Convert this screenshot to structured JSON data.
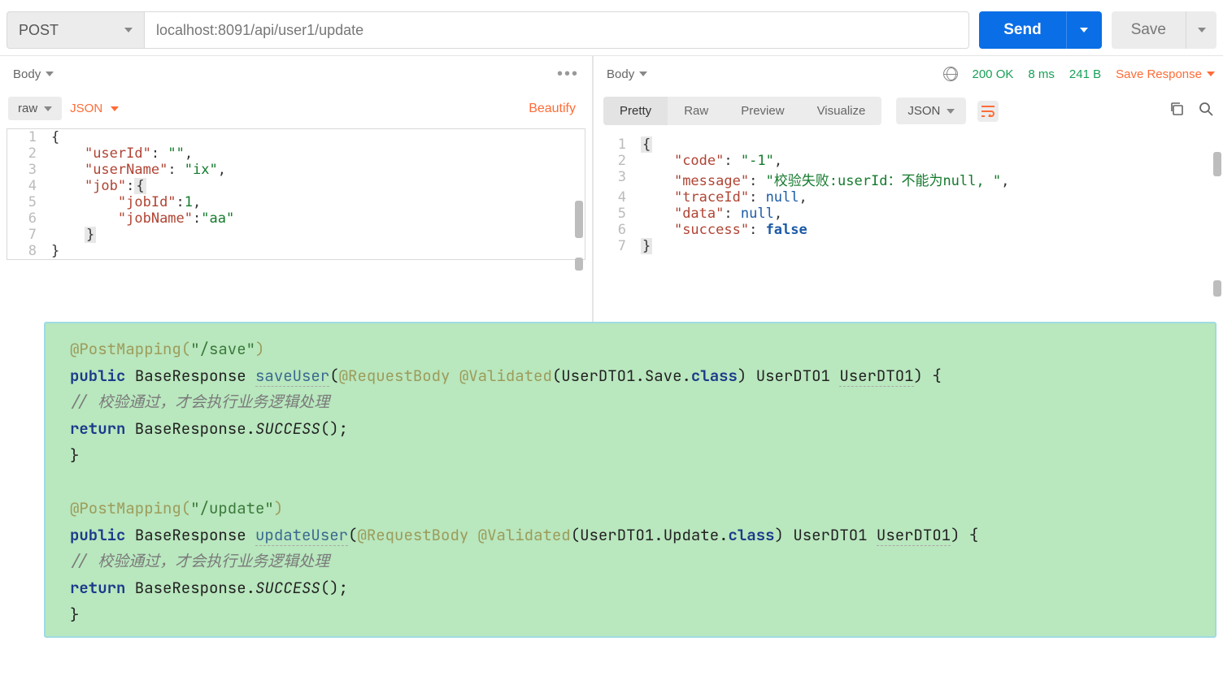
{
  "topbar": {
    "method": "POST",
    "url": "localhost:8091/api/user1/update",
    "send": "Send",
    "save": "Save"
  },
  "request": {
    "tab_label": "Body",
    "raw_label": "raw",
    "format_label": "JSON",
    "beautify": "Beautify",
    "body_lines": [
      {
        "n": 1,
        "html": "<span class='tok-punc'>{</span>"
      },
      {
        "n": 2,
        "html": "    <span class='tok-key'>\"userId\"</span><span class='tok-punc'>: </span><span class='tok-str'>\"\"</span><span class='tok-punc'>,</span>"
      },
      {
        "n": 3,
        "html": "    <span class='tok-key'>\"userName\"</span><span class='tok-punc'>: </span><span class='tok-str'>\"ix\"</span><span class='tok-punc'>,</span>"
      },
      {
        "n": 4,
        "html": "    <span class='tok-key'>\"job\"</span><span class='tok-punc'>:</span><span class='hl'>{</span>"
      },
      {
        "n": 5,
        "html": "        <span class='tok-key'>\"jobId\"</span><span class='tok-punc'>:</span><span class='tok-num'>1</span><span class='tok-punc'>,</span>"
      },
      {
        "n": 6,
        "html": "        <span class='tok-key'>\"jobName\"</span><span class='tok-punc'>:</span><span class='tok-str'>\"aa\"</span>"
      },
      {
        "n": 7,
        "html": "    <span class='hl'>}</span>"
      },
      {
        "n": 8,
        "html": "<span class='tok-punc'>}</span>"
      }
    ]
  },
  "response": {
    "tab_label": "Body",
    "status": "200 OK",
    "time": "8 ms",
    "size": "241 B",
    "save_resp": "Save Response",
    "tabs": {
      "pretty": "Pretty",
      "raw": "Raw",
      "preview": "Preview",
      "visualize": "Visualize"
    },
    "format_label": "JSON",
    "lines": [
      {
        "n": 1,
        "html": "<span class='hl'>{</span>"
      },
      {
        "n": 2,
        "html": "    <span class='tok-key'>\"code\"</span><span class='tok-punc'>: </span><span class='tok-str'>\"-1\"</span><span class='tok-punc'>,</span>"
      },
      {
        "n": 3,
        "html": "    <span class='tok-key'>\"message\"</span><span class='tok-punc'>: </span><span class='tok-str'>\"校验失败:userId：不能为null, \"</span><span class='tok-punc'>,</span>"
      },
      {
        "n": 4,
        "html": "    <span class='tok-key'>\"traceId\"</span><span class='tok-punc'>: </span><span class='tok-null'>null</span><span class='tok-punc'>,</span>"
      },
      {
        "n": 5,
        "html": "    <span class='tok-key'>\"data\"</span><span class='tok-punc'>: </span><span class='tok-null'>null</span><span class='tok-punc'>,</span>"
      },
      {
        "n": 6,
        "html": "    <span class='tok-key'>\"success\"</span><span class='tok-punc'>: </span><span class='tok-bool'>false</span>"
      },
      {
        "n": 7,
        "html": "<span class='hl'>}</span>"
      }
    ]
  },
  "snippet": {
    "lines": [
      "<span class='sn-ann'>@PostMapping(</span><span class='sn-str'>\"/save\"</span><span class='sn-ann'>)</span>",
      "<span class='sn-kw'>public</span> <span class='sn-type'>BaseResponse</span> <span class='sn-name sn-underl'>saveUser</span>(<span class='sn-ann'>@RequestBody</span> <span class='sn-ann'>@Validated</span>(UserDTO1.Save.<span class='sn-kw'>class</span>) UserDTO1 <span class='sn-underl'>UserDTO1</span>) {",
      "    <span class='sn-comment'>// 校验通过，才会执行业务逻辑处理</span>",
      "    <span class='sn-kw'>return</span> BaseResponse.<span class='sn-it'>SUCCESS</span>();",
      "}",
      "",
      "<span class='sn-ann'>@PostMapping(</span><span class='sn-str'>\"/update\"</span><span class='sn-ann'>)</span>",
      "<span class='sn-kw'>public</span> <span class='sn-type'>BaseResponse</span> <span class='sn-name sn-underl'>updateUser</span>(<span class='sn-ann'>@RequestBody</span> <span class='sn-ann'>@Validated</span>(UserDTO1.Update.<span class='sn-kw'>class</span>) UserDTO1 <span class='sn-underl'>UserDTO1</span>) {",
      "    <span class='sn-comment'>// 校验通过，才会执行业务逻辑处理</span>",
      "    <span class='sn-kw'>return</span> BaseResponse.<span class='sn-it'>SUCCESS</span>();",
      "}"
    ]
  }
}
